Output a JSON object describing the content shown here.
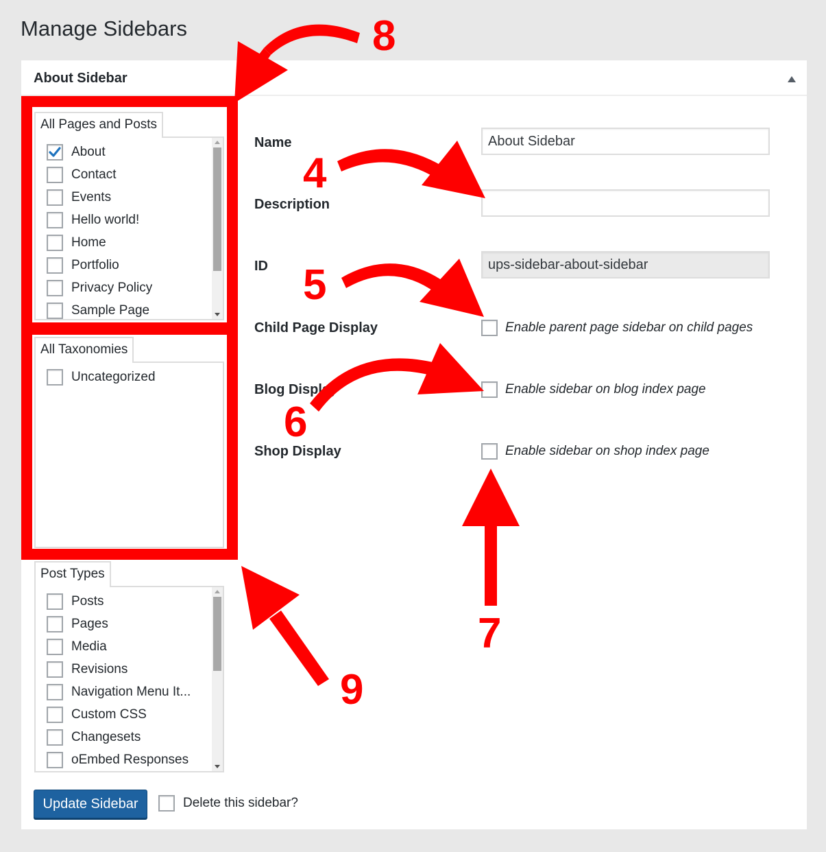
{
  "page": {
    "title": "Manage Sidebars"
  },
  "panel": {
    "title": "About Sidebar",
    "toggle_icon": "triangle-up-icon"
  },
  "pages_posts": {
    "tab_label": "All Pages and Posts",
    "items": [
      {
        "label": "About",
        "checked": true
      },
      {
        "label": "Contact",
        "checked": false
      },
      {
        "label": "Events",
        "checked": false
      },
      {
        "label": "Hello world!",
        "checked": false
      },
      {
        "label": "Home",
        "checked": false
      },
      {
        "label": "Portfolio",
        "checked": false
      },
      {
        "label": "Privacy Policy",
        "checked": false
      },
      {
        "label": "Sample Page",
        "checked": false
      }
    ]
  },
  "taxonomies": {
    "tab_label": "All Taxonomies",
    "items": [
      {
        "label": "Uncategorized",
        "checked": false
      }
    ]
  },
  "post_types": {
    "tab_label": "Post Types",
    "items": [
      {
        "label": "Posts",
        "checked": false
      },
      {
        "label": "Pages",
        "checked": false
      },
      {
        "label": "Media",
        "checked": false
      },
      {
        "label": "Revisions",
        "checked": false
      },
      {
        "label": "Navigation Menu It...",
        "checked": false
      },
      {
        "label": "Custom CSS",
        "checked": false
      },
      {
        "label": "Changesets",
        "checked": false
      },
      {
        "label": "oEmbed Responses",
        "checked": false
      }
    ]
  },
  "form": {
    "name_label": "Name",
    "name_value": "About Sidebar",
    "description_label": "Description",
    "description_value": "",
    "id_label": "ID",
    "id_value": "ups-sidebar-about-sidebar",
    "child_page_label": "Child Page Display",
    "child_page_option": "Enable parent page sidebar on child pages",
    "child_page_checked": false,
    "blog_label": "Blog Display",
    "blog_option": "Enable sidebar on blog index page",
    "blog_checked": false,
    "shop_label": "Shop Display",
    "shop_option": "Enable sidebar on shop index page",
    "shop_checked": false
  },
  "footer": {
    "update_button": "Update Sidebar",
    "delete_label": "Delete this sidebar?",
    "delete_checked": false
  },
  "annotations": {
    "color": "#fe0000",
    "numbers": [
      "8",
      "4",
      "5",
      "6",
      "7",
      "9"
    ]
  },
  "colors": {
    "primary_button": "#1e62a0",
    "checkmark": "#1e73be",
    "background": "#e8e8e8"
  }
}
